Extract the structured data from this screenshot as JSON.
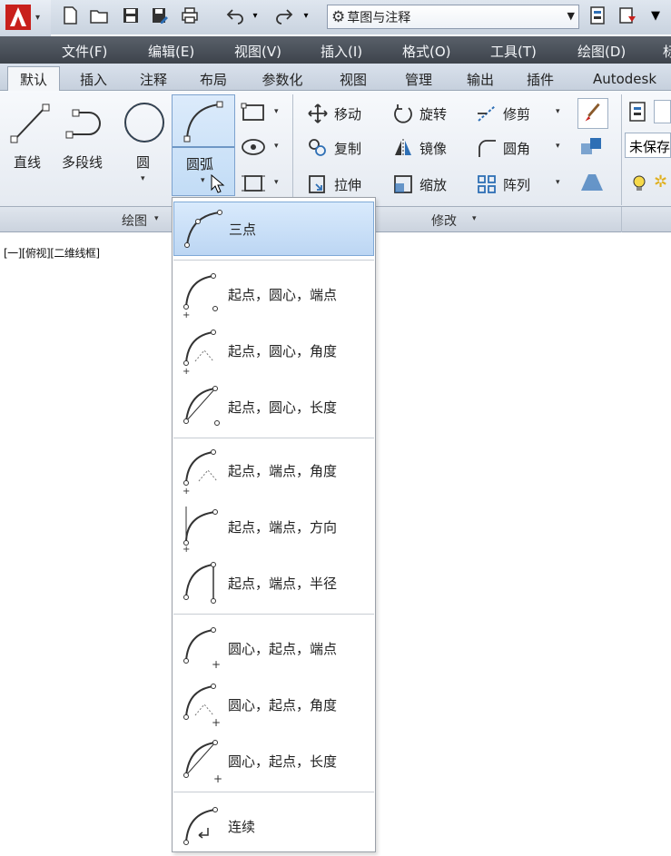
{
  "quick_access": {
    "workspace": "草图与注释"
  },
  "menubar": {
    "items": [
      "文件(F)",
      "编辑(E)",
      "视图(V)",
      "插入(I)",
      "格式(O)",
      "工具(T)",
      "绘图(D)"
    ]
  },
  "ribbon_tabs": [
    "默认",
    "插入",
    "注释",
    "布局",
    "参数化",
    "视图",
    "管理",
    "输出",
    "插件",
    "Autodesk"
  ],
  "draw_panel": {
    "line": "直线",
    "polyline": "多段线",
    "circle": "圆",
    "arc": "圆弧",
    "title": "绘图"
  },
  "modify_panel": {
    "move": "移动",
    "rotate": "旋转",
    "trim": "修剪",
    "copy": "复制",
    "mirror": "镜像",
    "fillet": "圆角",
    "stretch": "拉伸",
    "scale": "缩放",
    "array": "阵列",
    "title": "修改"
  },
  "layer_panel": {
    "unsaved": "未保存"
  },
  "viewport": {
    "label": "[一][俯视][二维线框]"
  },
  "arc_menu": {
    "items": [
      {
        "label": "三点",
        "icon": "arc-3point-icon"
      },
      {
        "label": "起点，圆心，端点",
        "icon": "arc-start-center-end-icon"
      },
      {
        "label": "起点，圆心，角度",
        "icon": "arc-start-center-angle-icon"
      },
      {
        "label": "起点，圆心，长度",
        "icon": "arc-start-center-length-icon"
      },
      {
        "label": "起点，端点，角度",
        "icon": "arc-start-end-angle-icon"
      },
      {
        "label": "起点，端点，方向",
        "icon": "arc-start-end-direction-icon"
      },
      {
        "label": "起点，端点，半径",
        "icon": "arc-start-end-radius-icon"
      },
      {
        "label": "圆心，起点，端点",
        "icon": "arc-center-start-end-icon"
      },
      {
        "label": "圆心，起点，角度",
        "icon": "arc-center-start-angle-icon"
      },
      {
        "label": "圆心，起点，长度",
        "icon": "arc-center-start-length-icon"
      },
      {
        "label": "连续",
        "icon": "arc-continue-icon"
      }
    ]
  },
  "colors": {
    "app_red": "#c8201c",
    "menubar_bg": "#474d55",
    "selection_blue": "#c6dcf5",
    "icon_blue": "#2e6fb5"
  }
}
